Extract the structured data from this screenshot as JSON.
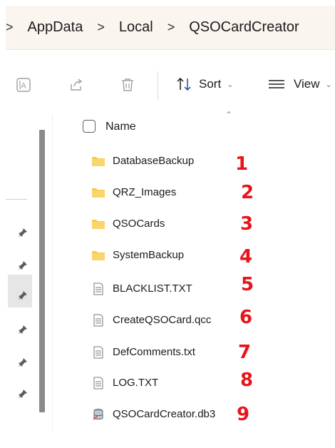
{
  "breadcrumb": {
    "separator": ">",
    "items": [
      "AppData",
      "Local",
      "QSOCardCreator"
    ]
  },
  "toolbar": {
    "sort_label": "Sort",
    "view_label": "View",
    "icons": [
      "rename-icon",
      "share-icon",
      "delete-icon",
      "sort-icon",
      "view-icon"
    ]
  },
  "nav_pane": {
    "pins": [
      "pin-icon",
      "pin-icon",
      "pin-icon",
      "pin-icon",
      "pin-icon",
      "pin-icon"
    ]
  },
  "file_list": {
    "column_header": "Name",
    "items": [
      {
        "name": "DatabaseBackup",
        "type": "folder",
        "annotation": "1"
      },
      {
        "name": "QRZ_Images",
        "type": "folder",
        "annotation": "2"
      },
      {
        "name": "QSOCards",
        "type": "folder",
        "annotation": "3"
      },
      {
        "name": "SystemBackup",
        "type": "folder",
        "annotation": "4"
      },
      {
        "name": "BLACKLIST.TXT",
        "type": "file",
        "annotation": "5"
      },
      {
        "name": "CreateQSOCard.qcc",
        "type": "file",
        "annotation": "6"
      },
      {
        "name": "DefComments.txt",
        "type": "file",
        "annotation": "7"
      },
      {
        "name": "LOG.TXT",
        "type": "file",
        "annotation": "8"
      },
      {
        "name": "QSOCardCreator.db3",
        "type": "database",
        "annotation": "9"
      }
    ]
  },
  "colors": {
    "folder": "#f6c94e",
    "annotation": "#e8141b",
    "address_bar_bg": "#fbf5f0"
  }
}
